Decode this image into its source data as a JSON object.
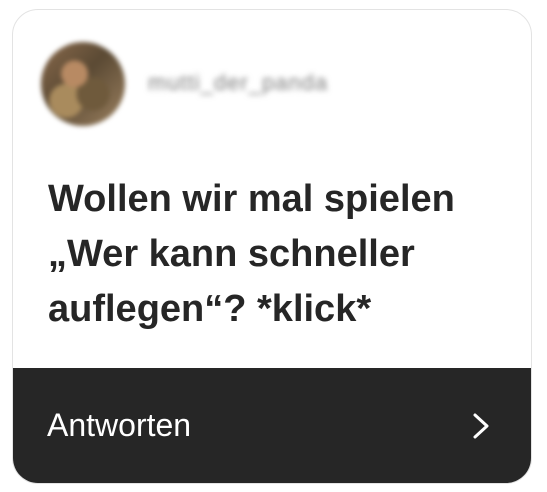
{
  "header": {
    "username": "mutti_der_panda",
    "avatar_icon": "profile-avatar-icon"
  },
  "question": {
    "text": "Wollen wir mal spielen „Wer kann schneller auflegen“? *klick*"
  },
  "reply": {
    "label": "Antworten",
    "icon": "chevron-right-icon"
  },
  "colors": {
    "text_dark": "#262626",
    "reply_background": "#262626",
    "reply_text": "#ffffff",
    "username_text": "#7d7d7d",
    "card_border": "#e3e3e3"
  }
}
